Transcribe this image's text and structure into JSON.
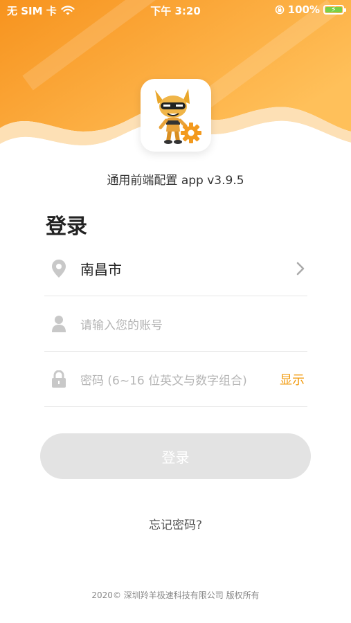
{
  "status_bar": {
    "carrier": "无 SIM 卡",
    "time": "下午 3:20",
    "battery": "100%",
    "battery_level": 1.0
  },
  "colors": {
    "brand_orange": "#f7931e",
    "accent_link": "#f29b0f",
    "button_disabled": "#e3e3e3"
  },
  "app_title": "通用前端配置 app v3.9.5",
  "login": {
    "heading": "登录",
    "city": "南昌市",
    "account_placeholder": "请输入您的账号",
    "password_placeholder": "密码 (6~16 位英文与数字组合)",
    "show_label": "显示",
    "submit_label": "登录",
    "forgot_label": "忘记密码?"
  },
  "icons": [
    "wifi-icon",
    "lock-rotation-icon",
    "battery-icon",
    "location-pin-icon",
    "chevron-right-icon",
    "user-icon",
    "padlock-icon",
    "mascot-logo-icon",
    "gear-icon"
  ],
  "footer": {
    "copyright": "2020© 深圳羚羊极速科技有限公司 版权所有"
  }
}
